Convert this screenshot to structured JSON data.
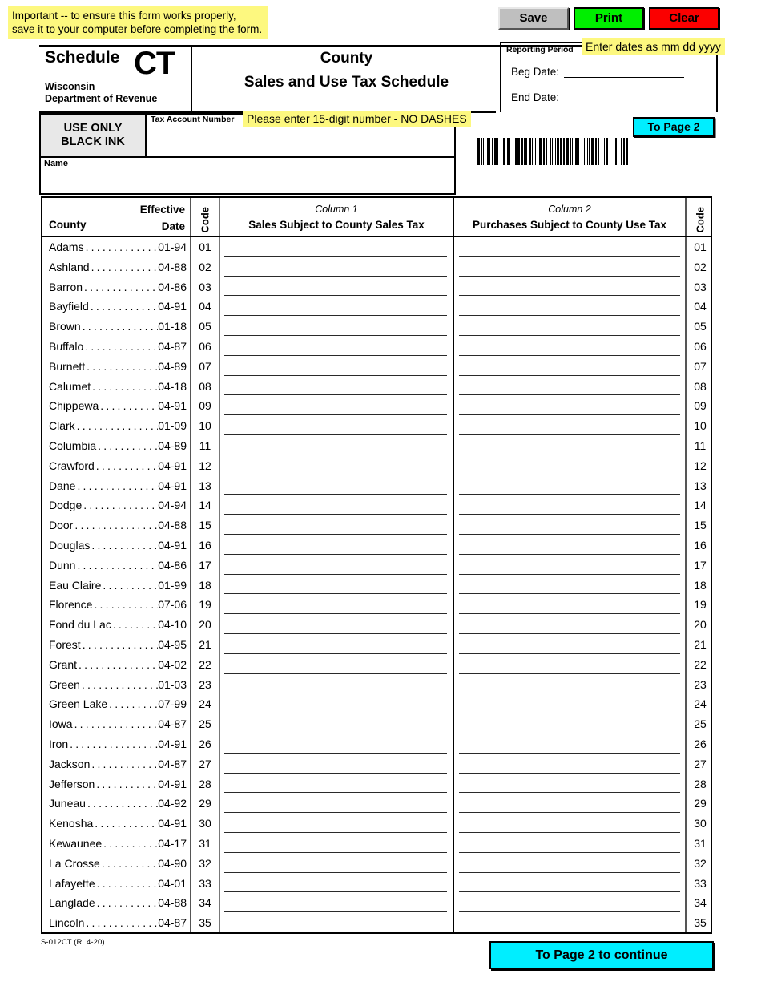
{
  "notice": {
    "text": "Important -- to ensure this form works properly,\nsave it to your computer before completing the form."
  },
  "toolbar": {
    "save_label": "Save",
    "print_label": "Print",
    "clear_label": "Clear",
    "save_color": "#bfbfbf",
    "print_color": "#00ef00",
    "clear_color": "#fb0000"
  },
  "reporting_period": {
    "legend": "Reporting Period",
    "beg_label": "Beg Date:",
    "end_label": "End Date:",
    "beg_value": "",
    "end_value": "",
    "hint": "Enter dates as mm dd yyyy",
    "hint_color": "#fdf87f"
  },
  "masthead": {
    "schedule_word": "Schedule",
    "schedule_code": "CT",
    "agency_line1": "Wisconsin",
    "agency_line2": "Department of Revenue",
    "title_line1": "County",
    "title_line2": "Sales and Use Tax Schedule"
  },
  "ink_notice": {
    "line1": "USE ONLY",
    "line2": "BLACK INK"
  },
  "account": {
    "label": "Tax Account Number",
    "value": "",
    "hint": "Please enter 15-digit number - NO DASHES"
  },
  "name_field": {
    "label": "Name",
    "value": ""
  },
  "nav": {
    "to_page_2": "To Page 2",
    "to_page_2_continue": "To Page 2 to continue",
    "button_color": "#00eeff"
  },
  "table": {
    "headers": {
      "county": "County",
      "effective_date": "Effective\nDate",
      "code": "Code",
      "col1_sub": "Column 1",
      "col1_main": "Sales Subject to County Sales Tax",
      "col2_sub": "Column 2",
      "col2_main": "Purchases Subject to County Use Tax"
    },
    "rows": [
      {
        "county": "Adams",
        "date": "01-94",
        "code": "01",
        "col1": "",
        "col2": ""
      },
      {
        "county": "Ashland",
        "date": "04-88",
        "code": "02",
        "col1": "",
        "col2": ""
      },
      {
        "county": "Barron",
        "date": "04-86",
        "code": "03",
        "col1": "",
        "col2": ""
      },
      {
        "county": "Bayfield",
        "date": "04-91",
        "code": "04",
        "col1": "",
        "col2": ""
      },
      {
        "county": "Brown",
        "date": "01-18",
        "code": "05",
        "col1": "",
        "col2": ""
      },
      {
        "county": "Buffalo",
        "date": "04-87",
        "code": "06",
        "col1": "",
        "col2": ""
      },
      {
        "county": "Burnett",
        "date": "04-89",
        "code": "07",
        "col1": "",
        "col2": ""
      },
      {
        "county": "Calumet",
        "date": "04-18",
        "code": "08",
        "col1": "",
        "col2": ""
      },
      {
        "county": "Chippewa",
        "date": "04-91",
        "code": "09",
        "col1": "",
        "col2": ""
      },
      {
        "county": "Clark",
        "date": "01-09",
        "code": "10",
        "col1": "",
        "col2": ""
      },
      {
        "county": "Columbia",
        "date": "04-89",
        "code": "11",
        "col1": "",
        "col2": ""
      },
      {
        "county": "Crawford",
        "date": "04-91",
        "code": "12",
        "col1": "",
        "col2": ""
      },
      {
        "county": "Dane",
        "date": "04-91",
        "code": "13",
        "col1": "",
        "col2": ""
      },
      {
        "county": "Dodge",
        "date": "04-94",
        "code": "14",
        "col1": "",
        "col2": ""
      },
      {
        "county": "Door",
        "date": "04-88",
        "code": "15",
        "col1": "",
        "col2": ""
      },
      {
        "county": "Douglas",
        "date": "04-91",
        "code": "16",
        "col1": "",
        "col2": ""
      },
      {
        "county": "Dunn",
        "date": "04-86",
        "code": "17",
        "col1": "",
        "col2": ""
      },
      {
        "county": "Eau Claire",
        "date": "01-99",
        "code": "18",
        "col1": "",
        "col2": ""
      },
      {
        "county": "Florence",
        "date": "07-06",
        "code": "19",
        "col1": "",
        "col2": ""
      },
      {
        "county": "Fond du Lac",
        "date": "04-10",
        "code": "20",
        "col1": "",
        "col2": ""
      },
      {
        "county": "Forest",
        "date": "04-95",
        "code": "21",
        "col1": "",
        "col2": ""
      },
      {
        "county": "Grant",
        "date": "04-02",
        "code": "22",
        "col1": "",
        "col2": ""
      },
      {
        "county": "Green",
        "date": "01-03",
        "code": "23",
        "col1": "",
        "col2": ""
      },
      {
        "county": "Green Lake",
        "date": "07-99",
        "code": "24",
        "col1": "",
        "col2": ""
      },
      {
        "county": "Iowa",
        "date": "04-87",
        "code": "25",
        "col1": "",
        "col2": ""
      },
      {
        "county": "Iron",
        "date": "04-91",
        "code": "26",
        "col1": "",
        "col2": ""
      },
      {
        "county": "Jackson",
        "date": "04-87",
        "code": "27",
        "col1": "",
        "col2": ""
      },
      {
        "county": "Jefferson",
        "date": "04-91",
        "code": "28",
        "col1": "",
        "col2": ""
      },
      {
        "county": "Juneau",
        "date": "04-92",
        "code": "29",
        "col1": "",
        "col2": ""
      },
      {
        "county": "Kenosha",
        "date": "04-91",
        "code": "30",
        "col1": "",
        "col2": ""
      },
      {
        "county": "Kewaunee",
        "date": "04-17",
        "code": "31",
        "col1": "",
        "col2": ""
      },
      {
        "county": "La Crosse",
        "date": "04-90",
        "code": "32",
        "col1": "",
        "col2": ""
      },
      {
        "county": "Lafayette",
        "date": "04-01",
        "code": "33",
        "col1": "",
        "col2": ""
      },
      {
        "county": "Langlade",
        "date": "04-88",
        "code": "34",
        "col1": "",
        "col2": ""
      },
      {
        "county": "Lincoln",
        "date": "04-87",
        "code": "35",
        "col1": "",
        "col2": ""
      }
    ]
  },
  "footer": {
    "form_number": "S-012CT (R. 4-20)"
  },
  "barcode": {
    "pattern": "3121132112213113121321131221312111232113121131221321131121312231211321131213112131221312113213112113122132"
  }
}
